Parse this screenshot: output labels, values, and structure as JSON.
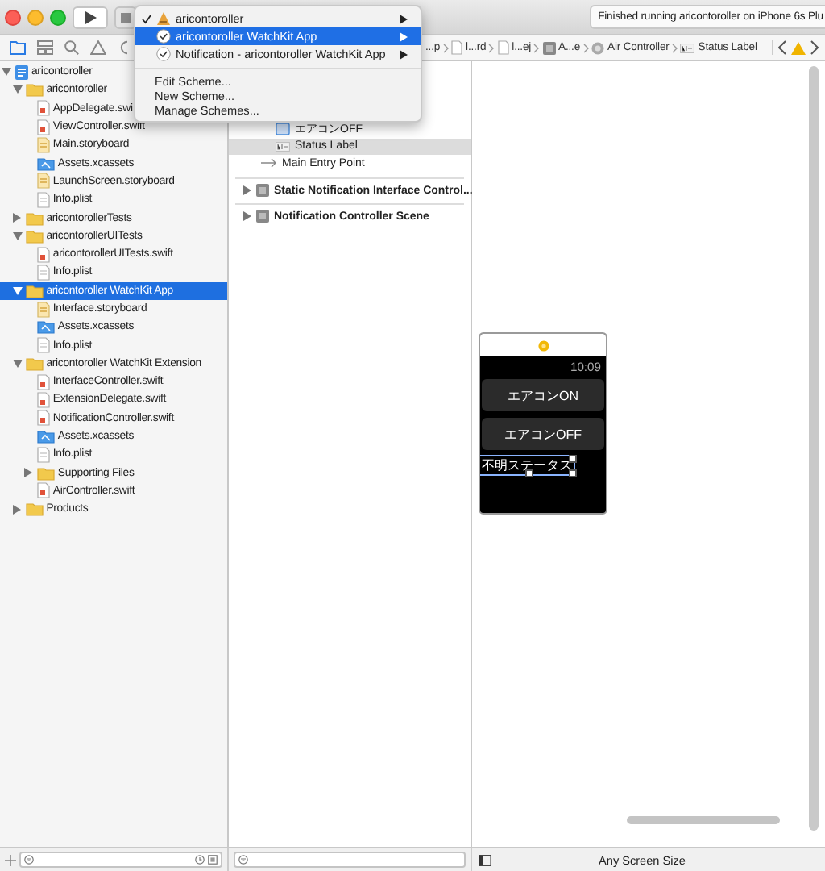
{
  "toolbar": {
    "status": "Finished running aricontoroller on iPhone 6s Plu"
  },
  "scheme_menu": {
    "items": [
      {
        "label": "aricontoroller",
        "kind": "app",
        "checked": true,
        "selected": false
      },
      {
        "label": "aricontoroller WatchKit App",
        "kind": "watch",
        "checked": false,
        "selected": true
      },
      {
        "label": "Notification - aricontoroller WatchKit App",
        "kind": "watch",
        "checked": false,
        "selected": false
      }
    ],
    "actions": [
      "Edit Scheme...",
      "New Scheme...",
      "Manage Schemes..."
    ]
  },
  "jump_bar": {
    "path": [
      {
        "label": "...p",
        "kind": "none"
      },
      {
        "label": "l...rd",
        "kind": "file"
      },
      {
        "label": "l...ej",
        "kind": "file"
      },
      {
        "label": "A...e",
        "kind": "scene"
      },
      {
        "label": "Air Controller",
        "kind": "controller"
      },
      {
        "label": "Status Label",
        "kind": "label"
      }
    ]
  },
  "navigator": {
    "tree": [
      {
        "name": "aricontoroller",
        "kind": "project",
        "expanded": true,
        "selected": false,
        "children": [
          {
            "name": "aricontoroller",
            "kind": "folder",
            "expanded": true,
            "selected": false,
            "children": [
              {
                "name": "AppDelegate.swi",
                "kind": "swift",
                "selected": false
              },
              {
                "name": "ViewController.swift",
                "kind": "swift",
                "selected": false
              },
              {
                "name": "Main.storyboard",
                "kind": "storyboard",
                "selected": false
              },
              {
                "name": "Assets.xcassets",
                "kind": "assets",
                "selected": false
              },
              {
                "name": "LaunchScreen.storyboard",
                "kind": "storyboard",
                "selected": false
              },
              {
                "name": "Info.plist",
                "kind": "plist",
                "selected": false
              }
            ]
          },
          {
            "name": "aricontorollerTests",
            "kind": "folder",
            "expanded": false,
            "selected": false
          },
          {
            "name": "aricontorollerUITests",
            "kind": "folder",
            "expanded": true,
            "selected": false,
            "children": [
              {
                "name": "aricontorollerUITests.swift",
                "kind": "swift",
                "selected": false
              },
              {
                "name": "Info.plist",
                "kind": "plist",
                "selected": false
              }
            ]
          },
          {
            "name": "aricontoroller WatchKit App",
            "kind": "folder",
            "expanded": true,
            "selected": true,
            "children": [
              {
                "name": "Interface.storyboard",
                "kind": "storyboard",
                "selected": false
              },
              {
                "name": "Assets.xcassets",
                "kind": "assets",
                "selected": false
              },
              {
                "name": "Info.plist",
                "kind": "plist",
                "selected": false
              }
            ]
          },
          {
            "name": "aricontoroller WatchKit Extension",
            "kind": "folder",
            "expanded": true,
            "selected": false,
            "children": [
              {
                "name": "InterfaceController.swift",
                "kind": "swift",
                "selected": false
              },
              {
                "name": "ExtensionDelegate.swift",
                "kind": "swift",
                "selected": false
              },
              {
                "name": "NotificationController.swift",
                "kind": "swift",
                "selected": false
              },
              {
                "name": "Assets.xcassets",
                "kind": "assets",
                "selected": false
              },
              {
                "name": "Info.plist",
                "kind": "plist",
                "selected": false
              },
              {
                "name": "Supporting Files",
                "kind": "folder",
                "expanded": false,
                "selected": false
              },
              {
                "name": "AirController.swift",
                "kind": "swift",
                "selected": false
              }
            ]
          },
          {
            "name": "Products",
            "kind": "folder",
            "expanded": false,
            "selected": false
          }
        ]
      }
    ]
  },
  "outline": {
    "rows": [
      {
        "label": "エアコンOFF",
        "kind": "button",
        "selected": false
      },
      {
        "label": "Status Label",
        "kind": "label",
        "selected": true
      },
      {
        "label": "Main Entry Point",
        "kind": "entry",
        "selected": false
      }
    ],
    "scenes": [
      {
        "label": "Static Notification Interface Control...",
        "expanded": false
      },
      {
        "label": "Notification Controller Scene",
        "expanded": false
      }
    ]
  },
  "canvas": {
    "watch": {
      "time": "10:09",
      "buttons": [
        "エアコンON",
        "エアコンOFF"
      ],
      "label": "不明ステータス",
      "label_selected": true
    },
    "size_class": "Any Screen Size"
  }
}
